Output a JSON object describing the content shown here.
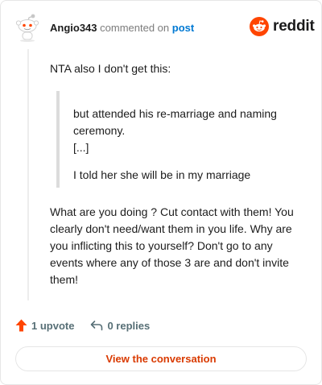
{
  "header": {
    "username": "Angio343",
    "commented_text": "commented on",
    "post_link": "post",
    "logo_text": "reddit"
  },
  "comment": {
    "intro": "NTA also I don't get this:",
    "quote": {
      "line1": "but attended his re-marriage and naming ceremony.",
      "line2": "[...]",
      "line3": "I told her she will be in my marriage"
    },
    "body": "What are you doing ? Cut contact with them! You clearly don't need/want them in you life. Why are you inflicting this to yourself? Don't go to any events where any of those 3 are and don't invite them!"
  },
  "actions": {
    "upvotes": "1 upvote",
    "replies": "0 replies"
  },
  "view_button": "View the conversation",
  "colors": {
    "brand": "#ff4500",
    "link": "#0079d3",
    "button_text": "#d93a00"
  }
}
